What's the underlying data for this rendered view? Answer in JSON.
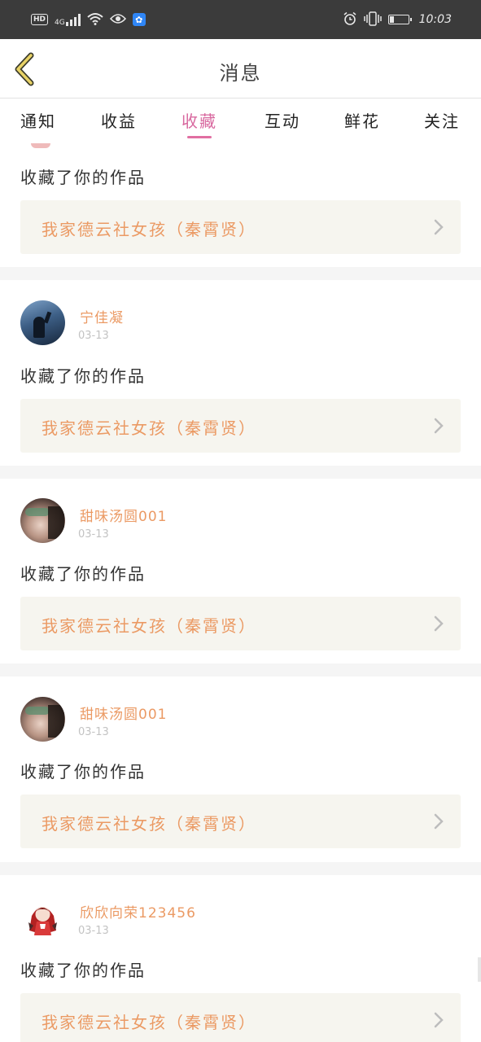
{
  "status_bar": {
    "left_badge": "HD",
    "network": "4G",
    "time": "10:03",
    "icons": [
      "hd-icon",
      "signal-icon",
      "wifi-icon",
      "eye-icon",
      "baidu-paw-icon",
      "alarm-icon",
      "vibrate-icon",
      "battery-charging-icon"
    ]
  },
  "header": {
    "title": "消息",
    "back_icon": "chevron-left-icon"
  },
  "tabs": [
    {
      "label": "通知"
    },
    {
      "label": "收益"
    },
    {
      "label": "收藏",
      "active": true
    },
    {
      "label": "互动"
    },
    {
      "label": "鲜花"
    },
    {
      "label": "关注"
    }
  ],
  "feed": [
    {
      "user": "",
      "date": "",
      "action": "收藏了你的作品",
      "work": "我家德云社女孩（秦霄贤）",
      "partial": true
    },
    {
      "user": "宁佳凝",
      "date": "03-13",
      "action": "收藏了你的作品",
      "work": "我家德云社女孩（秦霄贤）"
    },
    {
      "user": "甜味汤圆001",
      "date": "03-13",
      "action": "收藏了你的作品",
      "work": "我家德云社女孩（秦霄贤）"
    },
    {
      "user": "甜味汤圆001",
      "date": "03-13",
      "action": "收藏了你的作品",
      "work": "我家德云社女孩（秦霄贤）"
    },
    {
      "user": "欣欣向荣123456",
      "date": "03-13",
      "action": "收藏了你的作品",
      "work": "我家德云社女孩（秦霄贤）"
    }
  ],
  "colors": {
    "accent_pink": "#e16fa2",
    "username_orange": "#eb9a64",
    "work_bg": "#f6f5ef",
    "status_bar": "#3b3b3b"
  }
}
